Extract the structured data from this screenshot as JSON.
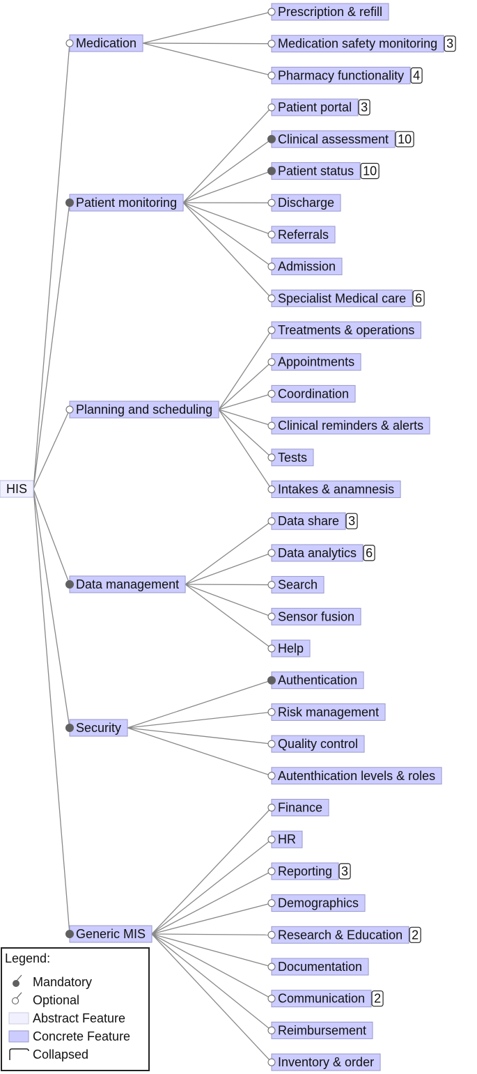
{
  "colors": {
    "concrete_fill": "#ccccff",
    "concrete_border": "#9999cc",
    "abstract_fill": "#f0f0ff",
    "mandatory": "#606060",
    "edge": "#888888"
  },
  "root": {
    "label": "HIS",
    "kind": "abstract"
  },
  "groups": [
    {
      "label": "Medication",
      "mandatory": false,
      "children": [
        {
          "label": "Prescription & refill",
          "mandatory": false
        },
        {
          "label": "Medication safety monitoring",
          "mandatory": false,
          "badge": "3"
        },
        {
          "label": "Pharmacy functionality",
          "mandatory": false,
          "badge": "4"
        }
      ]
    },
    {
      "label": "Patient monitoring",
      "mandatory": true,
      "children": [
        {
          "label": "Patient portal",
          "mandatory": false,
          "badge": "3"
        },
        {
          "label": "Clinical assessment",
          "mandatory": true,
          "badge": "10"
        },
        {
          "label": "Patient status",
          "mandatory": true,
          "badge": "10"
        },
        {
          "label": "Discharge",
          "mandatory": false
        },
        {
          "label": "Referrals",
          "mandatory": false
        },
        {
          "label": "Admission",
          "mandatory": false
        },
        {
          "label": "Specialist Medical care",
          "mandatory": false,
          "badge": "6"
        }
      ]
    },
    {
      "label": "Planning and scheduling",
      "mandatory": false,
      "children": [
        {
          "label": "Treatments & operations",
          "mandatory": false
        },
        {
          "label": "Appointments",
          "mandatory": false
        },
        {
          "label": "Coordination",
          "mandatory": false
        },
        {
          "label": "Clinical reminders & alerts",
          "mandatory": false
        },
        {
          "label": "Tests",
          "mandatory": false
        },
        {
          "label": "Intakes & anamnesis",
          "mandatory": false
        }
      ]
    },
    {
      "label": "Data management",
      "mandatory": true,
      "children": [
        {
          "label": "Data share",
          "mandatory": false,
          "badge": "3"
        },
        {
          "label": "Data analytics",
          "mandatory": false,
          "badge": "6"
        },
        {
          "label": "Search",
          "mandatory": false
        },
        {
          "label": "Sensor fusion",
          "mandatory": false
        },
        {
          "label": "Help",
          "mandatory": false
        }
      ]
    },
    {
      "label": "Security",
      "mandatory": true,
      "children": [
        {
          "label": "Authentication",
          "mandatory": true
        },
        {
          "label": "Risk management",
          "mandatory": false
        },
        {
          "label": "Quality control",
          "mandatory": false
        },
        {
          "label": "Autenthication levels & roles",
          "mandatory": false
        }
      ]
    },
    {
      "label": "Generic MIS",
      "mandatory": true,
      "children": [
        {
          "label": "Finance",
          "mandatory": false
        },
        {
          "label": "HR",
          "mandatory": false
        },
        {
          "label": "Reporting",
          "mandatory": false,
          "badge": "3"
        },
        {
          "label": "Demographics",
          "mandatory": false
        },
        {
          "label": "Research & Education",
          "mandatory": false,
          "badge": "2"
        },
        {
          "label": "Documentation",
          "mandatory": false
        },
        {
          "label": "Communication",
          "mandatory": false,
          "badge": "2"
        },
        {
          "label": "Reimbursement",
          "mandatory": false
        },
        {
          "label": "Inventory & order",
          "mandatory": false
        }
      ]
    }
  ],
  "legend": {
    "title": "Legend:",
    "items": [
      "Mandatory",
      "Optional",
      "Abstract Feature",
      "Concrete Feature",
      "Collapsed"
    ]
  }
}
